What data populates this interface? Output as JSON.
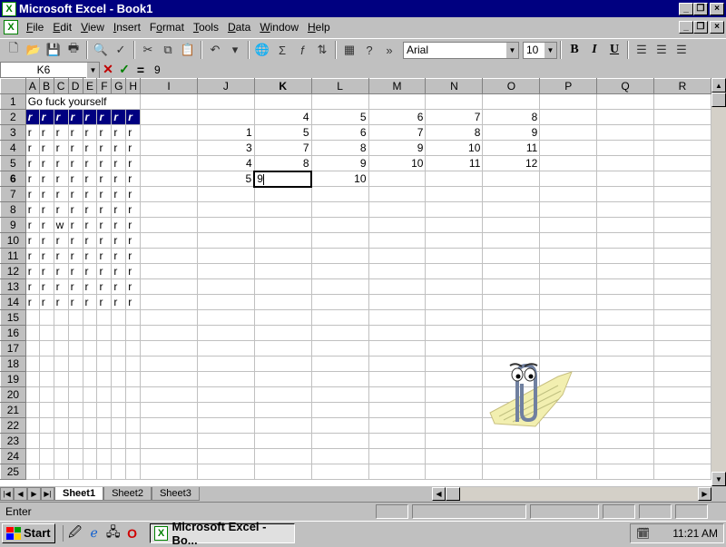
{
  "window": {
    "title": "Microsoft Excel - Book1",
    "app_icon": "X",
    "controls": [
      "_",
      "❐",
      "×"
    ]
  },
  "menubar": {
    "items": [
      "File",
      "Edit",
      "View",
      "Insert",
      "Format",
      "Tools",
      "Data",
      "Window",
      "Help"
    ],
    "underline_index": [
      0,
      0,
      0,
      0,
      1,
      0,
      0,
      0,
      0
    ]
  },
  "toolbar": {
    "font": "Arial",
    "size": "10",
    "bold": "B",
    "italic": "I",
    "underline": "U"
  },
  "formulabar": {
    "namebox": "K6",
    "cancel": "✕",
    "confirm": "✓",
    "equals": "=",
    "content": "9"
  },
  "grid": {
    "columns": [
      "A",
      "B",
      "C",
      "D",
      "E",
      "F",
      "G",
      "H",
      "I",
      "J",
      "K",
      "L",
      "M",
      "N",
      "O",
      "P",
      "Q",
      "R"
    ],
    "active_column": "K",
    "active_row": 6,
    "row_count": 25,
    "a1_text": "Go fuck yourself",
    "fill_letter": "r",
    "row9_c": "w",
    "numbers": {
      "r2": {
        "K": "4",
        "L": "5",
        "M": "6",
        "N": "7",
        "O": "8"
      },
      "r3": {
        "J": "1",
        "K": "5",
        "L": "6",
        "M": "7",
        "N": "8",
        "O": "9"
      },
      "r4": {
        "J": "3",
        "K": "7",
        "L": "8",
        "M": "9",
        "N": "10",
        "O": "11"
      },
      "r5": {
        "J": "4",
        "K": "8",
        "L": "9",
        "M": "10",
        "N": "11",
        "O": "12"
      },
      "r6": {
        "J": "5",
        "K": "9",
        "L": "10"
      }
    }
  },
  "sheets": {
    "tabs": [
      "Sheet1",
      "Sheet2",
      "Sheet3"
    ],
    "active": "Sheet1"
  },
  "status": {
    "mode": "Enter"
  },
  "taskbar": {
    "start": "Start",
    "task": "Microsoft Excel - Bo...",
    "clock": "11:21 AM"
  }
}
